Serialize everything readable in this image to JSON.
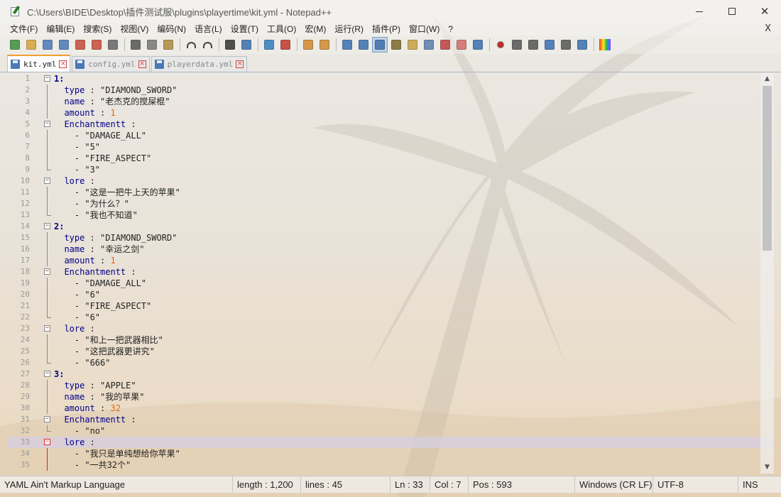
{
  "window": {
    "title": "C:\\Users\\BIDE\\Desktop\\插件测试服\\plugins\\playertime\\kit.yml - Notepad++"
  },
  "menu": [
    "文件(F)",
    "编辑(E)",
    "搜索(S)",
    "视图(V)",
    "编码(N)",
    "语言(L)",
    "设置(T)",
    "工具(O)",
    "宏(M)",
    "运行(R)",
    "插件(P)",
    "窗口(W)",
    "?"
  ],
  "menu_close": "X",
  "tabs": [
    {
      "label": "kit.yml",
      "active": true
    },
    {
      "label": "config.yml",
      "active": false
    },
    {
      "label": "playerdata.yml",
      "active": false
    }
  ],
  "lines": [
    {
      "n": "1",
      "fold": "open",
      "t": [
        [
          "k",
          "1:"
        ]
      ]
    },
    {
      "n": "2",
      "t": [
        [
          "s",
          "  "
        ],
        [
          "kl",
          "type"
        ],
        [
          "o",
          " : "
        ],
        [
          "s",
          "\"DIAMOND_SWORD\""
        ]
      ]
    },
    {
      "n": "3",
      "t": [
        [
          "s",
          "  "
        ],
        [
          "kl",
          "name"
        ],
        [
          "o",
          " : "
        ],
        [
          "s",
          "\"老杰克的搅屎棍\""
        ]
      ]
    },
    {
      "n": "4",
      "t": [
        [
          "s",
          "  "
        ],
        [
          "kl",
          "amount"
        ],
        [
          "o",
          " : "
        ],
        [
          "n",
          "1"
        ]
      ]
    },
    {
      "n": "5",
      "fold": "open",
      "t": [
        [
          "s",
          "  "
        ],
        [
          "kl",
          "Enchantmentt"
        ],
        [
          "o",
          " :"
        ]
      ]
    },
    {
      "n": "6",
      "t": [
        [
          "s",
          "    - \"DAMAGE_ALL\""
        ]
      ]
    },
    {
      "n": "7",
      "t": [
        [
          "s",
          "    - \"5\""
        ]
      ]
    },
    {
      "n": "8",
      "t": [
        [
          "s",
          "    - \"FIRE_ASPECT\""
        ]
      ]
    },
    {
      "n": "9",
      "fold": "end",
      "t": [
        [
          "s",
          "    - \"3\""
        ]
      ]
    },
    {
      "n": "10",
      "fold": "open",
      "t": [
        [
          "s",
          "  "
        ],
        [
          "kl",
          "lore"
        ],
        [
          "o",
          " :"
        ]
      ]
    },
    {
      "n": "11",
      "t": [
        [
          "s",
          "    - \"这是一把牛上天的苹果\""
        ]
      ]
    },
    {
      "n": "12",
      "t": [
        [
          "s",
          "    - \"为什么？\""
        ]
      ]
    },
    {
      "n": "13",
      "fold": "end",
      "t": [
        [
          "s",
          "    - \"我也不知道\""
        ]
      ]
    },
    {
      "n": "14",
      "fold": "open",
      "t": [
        [
          "k",
          "2:"
        ]
      ]
    },
    {
      "n": "15",
      "t": [
        [
          "s",
          "  "
        ],
        [
          "kl",
          "type"
        ],
        [
          "o",
          " : "
        ],
        [
          "s",
          "\"DIAMOND_SWORD\""
        ]
      ]
    },
    {
      "n": "16",
      "t": [
        [
          "s",
          "  "
        ],
        [
          "kl",
          "name"
        ],
        [
          "o",
          " : "
        ],
        [
          "s",
          "\"幸运之剑\""
        ]
      ]
    },
    {
      "n": "17",
      "t": [
        [
          "s",
          "  "
        ],
        [
          "kl",
          "amount"
        ],
        [
          "o",
          " : "
        ],
        [
          "n",
          "1"
        ]
      ]
    },
    {
      "n": "18",
      "fold": "open",
      "t": [
        [
          "s",
          "  "
        ],
        [
          "kl",
          "Enchantmentt"
        ],
        [
          "o",
          " :"
        ]
      ]
    },
    {
      "n": "19",
      "t": [
        [
          "s",
          "    - \"DAMAGE_ALL\""
        ]
      ]
    },
    {
      "n": "20",
      "t": [
        [
          "s",
          "    - \"6\""
        ]
      ]
    },
    {
      "n": "21",
      "t": [
        [
          "s",
          "    - \"FIRE_ASPECT\""
        ]
      ]
    },
    {
      "n": "22",
      "fold": "end",
      "t": [
        [
          "s",
          "    - \"6\""
        ]
      ]
    },
    {
      "n": "23",
      "fold": "open",
      "t": [
        [
          "s",
          "  "
        ],
        [
          "kl",
          "lore"
        ],
        [
          "o",
          " :"
        ]
      ]
    },
    {
      "n": "24",
      "t": [
        [
          "s",
          "    - \"和上一把武器相比\""
        ]
      ]
    },
    {
      "n": "25",
      "t": [
        [
          "s",
          "    - \"这把武器更讲究\""
        ]
      ]
    },
    {
      "n": "26",
      "fold": "end",
      "t": [
        [
          "s",
          "    - \"666\""
        ]
      ]
    },
    {
      "n": "27",
      "fold": "open",
      "t": [
        [
          "k",
          "3:"
        ]
      ]
    },
    {
      "n": "28",
      "t": [
        [
          "s",
          "  "
        ],
        [
          "kl",
          "type"
        ],
        [
          "o",
          " : "
        ],
        [
          "s",
          "\"APPLE\""
        ]
      ]
    },
    {
      "n": "29",
      "t": [
        [
          "s",
          "  "
        ],
        [
          "kl",
          "name"
        ],
        [
          "o",
          " : "
        ],
        [
          "s",
          "\"我的苹果\""
        ]
      ]
    },
    {
      "n": "30",
      "t": [
        [
          "s",
          "  "
        ],
        [
          "kl",
          "amount"
        ],
        [
          "o",
          " : "
        ],
        [
          "n",
          "32"
        ]
      ]
    },
    {
      "n": "31",
      "fold": "open",
      "t": [
        [
          "s",
          "  "
        ],
        [
          "kl",
          "Enchantmentt"
        ],
        [
          "o",
          " :"
        ]
      ]
    },
    {
      "n": "32",
      "fold": "end",
      "t": [
        [
          "s",
          "    - \"no\""
        ]
      ]
    },
    {
      "n": "33",
      "fold": "open-red",
      "current": true,
      "t": [
        [
          "s",
          "  "
        ],
        [
          "kl",
          "lore"
        ],
        [
          "o",
          " :"
        ]
      ]
    },
    {
      "n": "34",
      "fold": "red",
      "t": [
        [
          "s",
          "    - \"我只是单纯想给你苹果\""
        ]
      ]
    },
    {
      "n": "35",
      "fold": "red",
      "t": [
        [
          "s",
          "    - \"一共32个\""
        ]
      ]
    }
  ],
  "status": {
    "language": "YAML Ain't Markup Language",
    "length": "length : 1,200",
    "lines": "lines : 45",
    "ln": "Ln : 33",
    "col": "Col : 7",
    "pos": "Pos : 593",
    "eol": "Windows (CR LF)",
    "encoding": "UTF-8",
    "mode": "INS"
  },
  "colors": {
    "keyword": "#00008b",
    "number": "#e06a10",
    "current_line": "#d6cee2",
    "active_tab_accent": "#f0a030"
  },
  "toolbar_icons": [
    "new-file-icon",
    "open-file-icon",
    "save-icon",
    "save-all-icon",
    "close-icon",
    "close-all-icon",
    "print-icon",
    "cut-icon",
    "copy-icon",
    "paste-icon",
    "undo-icon",
    "redo-icon",
    "find-icon",
    "replace-icon",
    "zoom-in-icon",
    "zoom-out-icon",
    "sync-vertical-icon",
    "sync-horizontal-icon",
    "word-wrap-icon",
    "show-all-chars-icon",
    "indent-guide-icon",
    "udl-icon",
    "doc-map-icon",
    "function-list-icon",
    "folder-workspace-icon",
    "monitor-icon",
    "eye-icon",
    "record-macro-icon",
    "stop-macro-icon",
    "play-macro-icon",
    "play-multiple-icon",
    "save-macro-icon",
    "toggle-panel-icon",
    "color-picker-icon"
  ]
}
